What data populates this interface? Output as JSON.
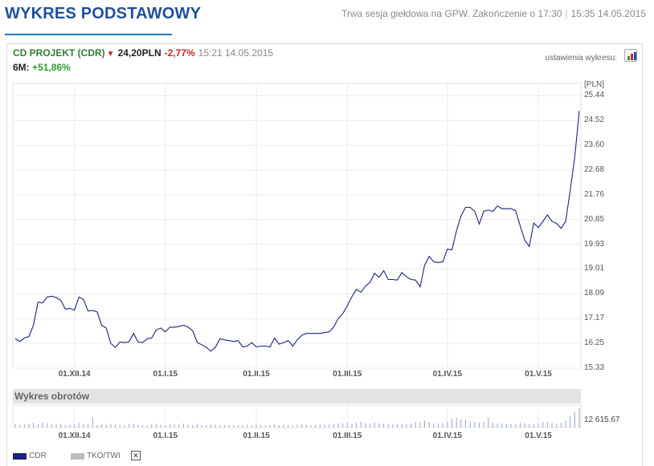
{
  "page": {
    "title": "WYKRES PODSTAWOWY",
    "session_text": "Trwa sesja giełdowa na GPW. Zakończenie o 17:30",
    "session_time": "15:35 14.05.2015"
  },
  "quote": {
    "name": "CD PROJEKT (CDR)",
    "direction_icon": "down-triangle-icon",
    "price": "24,20PLN",
    "change": "-2,77%",
    "time": "15:21 14.05.2015",
    "period_label": "6M:",
    "period_change": "+51,86%"
  },
  "settings": {
    "label": "ustawienia wykresu:",
    "icon": "chart-settings-icon"
  },
  "colors": {
    "line": "#1a237e",
    "title": "#1f4f9c",
    "up": "#2e9e2e",
    "down": "#c62828",
    "volume": "#8fa3c8"
  },
  "chart_data": {
    "type": "line",
    "ylabel": "[PLN]",
    "ylim": [
      15.33,
      25.9
    ],
    "yticks": [
      15.33,
      16.25,
      17.17,
      18.09,
      19.01,
      19.93,
      20.85,
      21.76,
      22.68,
      23.6,
      24.52,
      25.44
    ],
    "ytick_labels": [
      "15.33",
      "16.25",
      "17.17",
      "18.09",
      "19.01",
      "19.93",
      "20.85",
      "21.76",
      "22.68",
      "23.60",
      "24.52",
      "25.44"
    ],
    "xticks": [
      {
        "label": "01.XII.14",
        "index": 13
      },
      {
        "label": "01.I.15",
        "index": 33
      },
      {
        "label": "01.II.15",
        "index": 53
      },
      {
        "label": "01.III.15",
        "index": 73
      },
      {
        "label": "01.IV.15",
        "index": 95
      },
      {
        "label": "01.V.15",
        "index": 115
      }
    ],
    "grid": true,
    "series": [
      {
        "name": "CDR",
        "values": [
          16.42,
          16.32,
          16.45,
          16.5,
          16.92,
          17.78,
          17.75,
          17.97,
          18.0,
          17.95,
          17.85,
          17.52,
          17.55,
          17.48,
          17.97,
          17.88,
          17.45,
          17.47,
          17.42,
          16.92,
          16.82,
          16.25,
          16.1,
          16.3,
          16.28,
          16.3,
          16.62,
          16.3,
          16.28,
          16.42,
          16.45,
          16.75,
          16.82,
          16.68,
          16.85,
          16.85,
          16.88,
          16.92,
          16.85,
          16.72,
          16.28,
          16.2,
          16.1,
          15.96,
          16.1,
          16.42,
          16.38,
          16.35,
          16.32,
          16.35,
          16.12,
          16.15,
          16.28,
          16.12,
          16.15,
          16.15,
          16.12,
          16.45,
          16.22,
          16.28,
          16.35,
          16.15,
          16.38,
          16.55,
          16.62,
          16.62,
          16.62,
          16.62,
          16.65,
          16.68,
          16.85,
          17.18,
          17.35,
          17.65,
          17.98,
          18.25,
          18.15,
          18.38,
          18.52,
          18.85,
          18.7,
          18.95,
          18.62,
          18.62,
          18.6,
          18.88,
          18.72,
          18.62,
          18.6,
          18.35,
          19.15,
          19.48,
          19.28,
          19.25,
          19.28,
          19.75,
          19.72,
          20.42,
          20.98,
          21.3,
          21.3,
          21.15,
          20.68,
          21.15,
          21.2,
          21.15,
          21.35,
          21.25,
          21.25,
          21.25,
          21.18,
          20.62,
          20.08,
          19.85,
          20.72,
          20.55,
          20.78,
          21.02,
          20.78,
          20.7,
          20.52,
          20.78,
          21.92,
          23.15,
          24.88
        ]
      }
    ],
    "volume": {
      "title": "Wykres obrotów",
      "label": "12 615.67",
      "max_reference": 12615.67,
      "values": [
        0.18,
        0.14,
        0.16,
        0.2,
        0.25,
        0.15,
        0.28,
        0.22,
        0.18,
        0.15,
        0.2,
        0.12,
        0.15,
        0.18,
        0.25,
        0.2,
        0.16,
        0.55,
        0.12,
        0.15,
        0.14,
        0.18,
        0.16,
        0.14,
        0.12,
        0.18,
        0.2,
        0.14,
        0.12,
        0.1,
        0.15,
        0.18,
        0.14,
        0.12,
        0.15,
        0.16,
        0.18,
        0.2,
        0.15,
        0.12,
        0.18,
        0.14,
        0.12,
        0.15,
        0.14,
        0.1,
        0.12,
        0.14,
        0.12,
        0.1,
        0.12,
        0.14,
        0.12,
        0.16,
        0.12,
        0.1,
        0.12,
        0.15,
        0.12,
        0.14,
        0.12,
        0.1,
        0.14,
        0.16,
        0.14,
        0.12,
        0.14,
        0.16,
        0.14,
        0.15,
        0.18,
        0.2,
        0.22,
        0.25,
        0.2,
        0.24,
        0.3,
        0.22,
        0.2,
        0.25,
        0.22,
        0.2,
        0.18,
        0.15,
        0.2,
        0.18,
        0.16,
        0.2,
        0.3,
        0.25,
        0.35,
        0.28,
        0.22,
        0.2,
        0.22,
        0.3,
        0.45,
        0.5,
        0.42,
        0.4,
        0.32,
        0.28,
        0.25,
        0.28,
        0.52,
        0.25,
        0.22,
        0.2,
        0.18,
        0.2,
        0.18,
        0.25,
        0.22,
        0.18,
        0.2,
        0.22,
        0.28,
        0.3,
        0.25,
        0.2,
        0.25,
        0.35,
        0.6,
        0.8,
        1.0
      ]
    },
    "legend": [
      {
        "label": "CDR",
        "color": "#1a237e"
      },
      {
        "label": "TKO/TWI",
        "color": "#bdbdbd"
      }
    ]
  }
}
